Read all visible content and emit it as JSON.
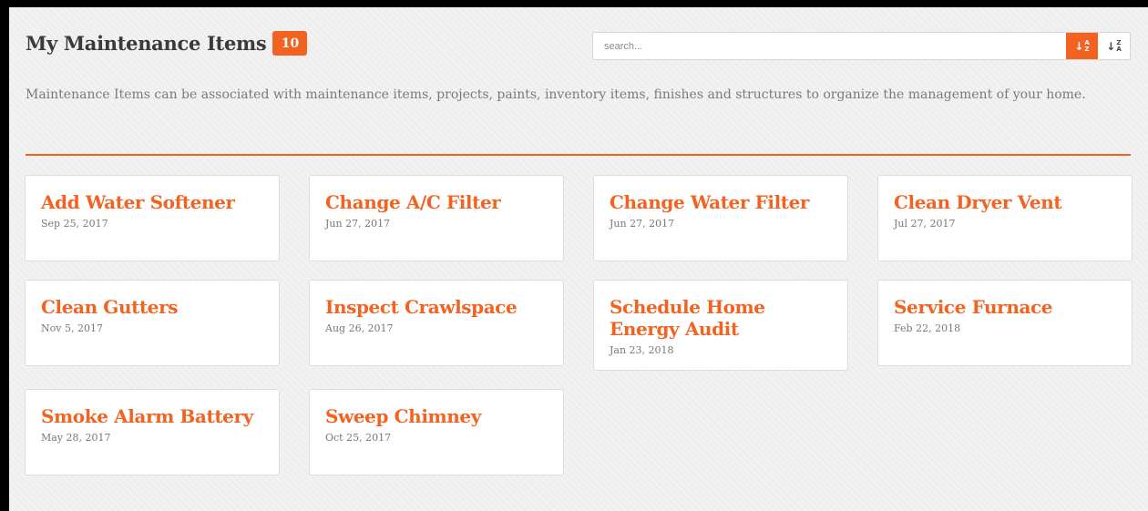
{
  "header": {
    "title": "My Maintenance Items",
    "count": "10"
  },
  "search": {
    "placeholder": "search...",
    "value": ""
  },
  "sort": {
    "az_label": "A→Z",
    "za_label": "Z→A",
    "active": "az"
  },
  "description": "Maintenance Items can be associated with maintenance items, projects, paints, inventory items, finishes and structures to organize the management of your home.",
  "colors": {
    "accent": "#f26322",
    "text": "#3a3a3a",
    "muted": "#7a7a7a",
    "background": "#f2f2f2"
  },
  "items": [
    {
      "title": "Add Water Softener",
      "date": "Sep 25, 2017"
    },
    {
      "title": "Change A/C Filter",
      "date": "Jun 27, 2017"
    },
    {
      "title": "Change Water Filter",
      "date": "Jun 27, 2017"
    },
    {
      "title": "Clean Dryer Vent",
      "date": "Jul 27, 2017"
    },
    {
      "title": "Clean Gutters",
      "date": "Nov 5, 2017"
    },
    {
      "title": "Inspect Crawlspace",
      "date": "Aug 26, 2017"
    },
    {
      "title": "Schedule Home Energy Audit",
      "date": "Jan 23, 2018"
    },
    {
      "title": "Service Furnace",
      "date": "Feb 22, 2018"
    },
    {
      "title": "Smoke Alarm Battery",
      "date": "May 28, 2017"
    },
    {
      "title": "Sweep Chimney",
      "date": "Oct 25, 2017"
    }
  ]
}
